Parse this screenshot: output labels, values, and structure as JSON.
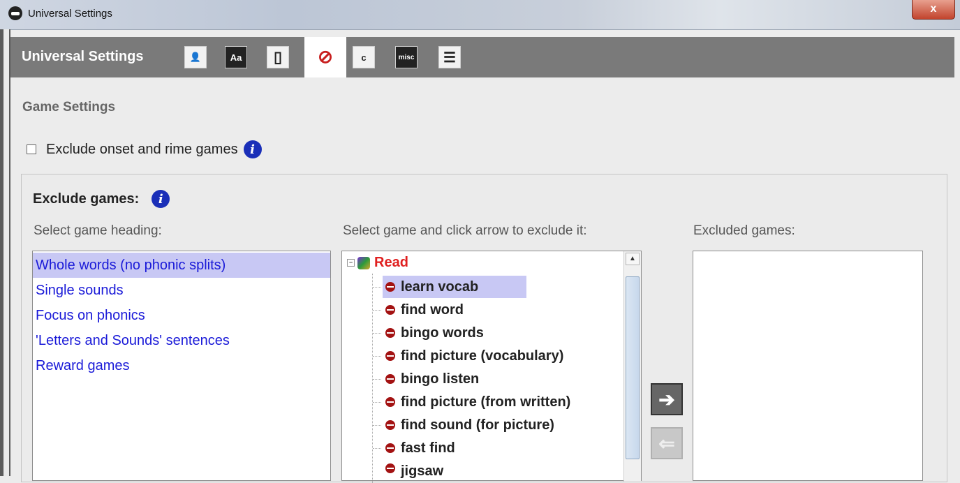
{
  "window": {
    "title": "Universal Settings",
    "close_label": "x"
  },
  "toolbar": {
    "title": "Universal Settings",
    "buttons": [
      {
        "name": "user-settings",
        "icon": "user-icon",
        "glyph": "👤"
      },
      {
        "name": "font-settings",
        "icon": "font-icon",
        "glyph": "Aa"
      },
      {
        "name": "display-settings",
        "icon": "frame-icon",
        "glyph": "▯"
      },
      {
        "name": "game-settings",
        "icon": "no-games-icon",
        "glyph": "⊘",
        "selected": true
      },
      {
        "name": "copy-settings",
        "icon": "copy-icon",
        "glyph": "c"
      },
      {
        "name": "misc-settings",
        "icon": "misc-icon",
        "glyph": "misc"
      },
      {
        "name": "list-settings",
        "icon": "checklist-icon",
        "glyph": "☰"
      }
    ]
  },
  "section_title": "Game Settings",
  "onset_checkbox": {
    "label": "Exclude onset and rime games",
    "checked": false
  },
  "exclude_panel": {
    "title": "Exclude games:",
    "heading_label": "Select game heading:",
    "game_label": "Select game and click arrow to exclude it:",
    "excluded_label": "Excluded games:",
    "headings": [
      "Whole words (no phonic splits)",
      "Single sounds",
      "Focus on phonics",
      "'Letters and Sounds' sentences",
      "Reward games"
    ],
    "tree_root": "Read",
    "games": [
      "learn vocab",
      "find word",
      "bingo words",
      "find picture (vocabulary)",
      "bingo listen",
      "find picture (from written)",
      "find sound (for picture)",
      "fast find",
      "jigsaw"
    ],
    "excluded": []
  },
  "info_glyph": "i",
  "scroll_up_glyph": "▲",
  "tree_toggle_glyph": "−",
  "arrows": {
    "exclude": "➔",
    "include": "⇐"
  }
}
